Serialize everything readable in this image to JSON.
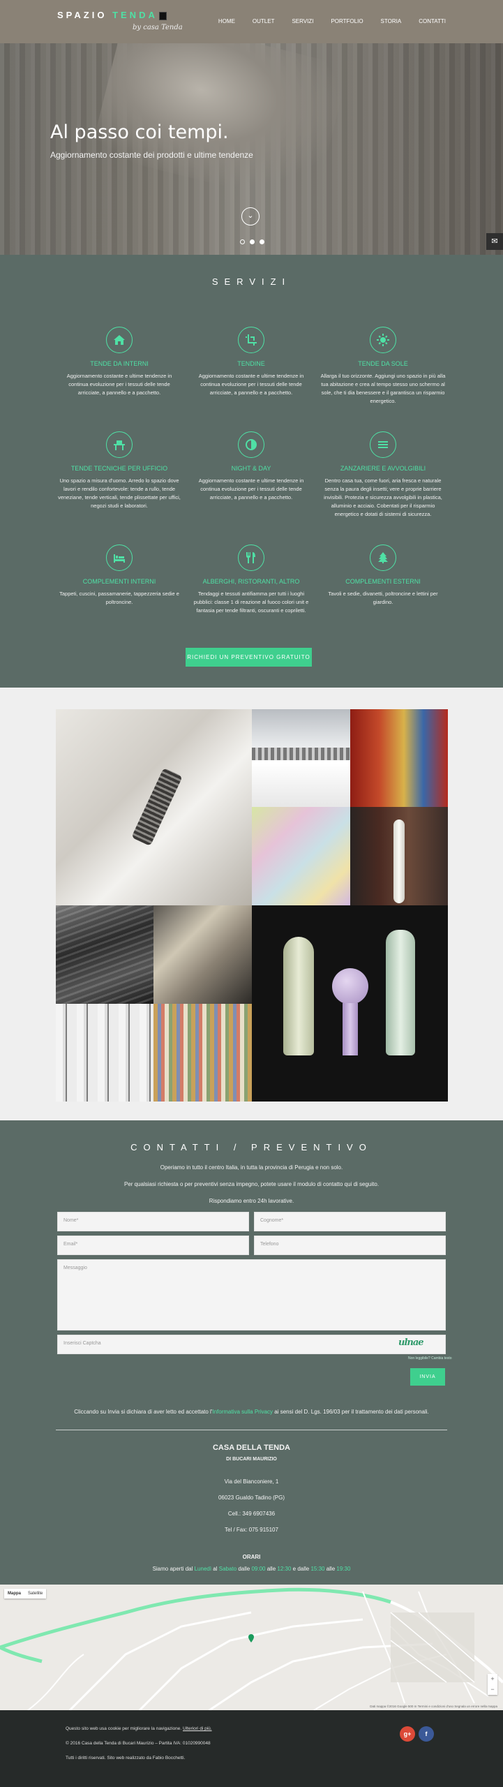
{
  "header": {
    "logo": {
      "main_a": "SPAZIO",
      "main_b": "TENDA",
      "sub": "by casa Tenda"
    },
    "nav": [
      "HOME",
      "OUTLET",
      "SERVIZI",
      "PORTFOLIO",
      "STORIA",
      "CONTATTI"
    ]
  },
  "hero": {
    "title": "Al passo coi tempi.",
    "subtitle": "Aggiornamento costante dei prodotti e ultime tendenze",
    "slides": 3,
    "active_slide": 1
  },
  "services": {
    "title": "SERVIZI",
    "items": [
      {
        "icon": "home-icon",
        "title": "TENDE DA INTERNI",
        "text": "Aggiornamento costante e ultime tendenze in continua evoluzione per i tessuti delle tende arricciate, a pannello e a pacchetto."
      },
      {
        "icon": "crop-icon",
        "title": "TENDINE",
        "text": "Aggiornamento costante e ultime tendenze in continua evoluzione per i tessuti delle tende arricciate, a pannello e a pacchetto."
      },
      {
        "icon": "sun-icon",
        "title": "TENDE DA SOLE",
        "text": "Allarga il tuo orizzonte. Aggiungi uno spazio in più alla tua abitazione e crea al tempo stesso uno schermo al sole, che ti dia benessere e il garantisca un risparmio energetico."
      },
      {
        "icon": "office-icon",
        "title": "TENDE TECNICHE PER UFFICIO",
        "text": "Uno spazio a misura d'uomo. Arredo lo spazio dove lavori e rendilo confortevole: tende a rullo, tende veneziane, tende verticali, tende plissettate per uffici, negozi studi e laboratori."
      },
      {
        "icon": "contrast-icon",
        "title": "NIGHT & DAY",
        "text": "Aggiornamento costante e ultime tendenze in continua evoluzione per i tessuti delle tende arricciate, a pannello e a pacchetto."
      },
      {
        "icon": "menu-icon",
        "title": "ZANZARIERE E AVVOLGIBILI",
        "text": "Dentro casa tua, come fuori, aria fresca e naturale senza la paura degli insetti; vere e proprie barriere invisibili. Protezia e sicurezza avvolgibili in plastica, alluminio e acciaio. Cobentati per il risparmio energetico e dotati di sistemi di sicurezza."
      },
      {
        "icon": "bed-icon",
        "title": "COMPLEMENTI INTERNI",
        "text": "Tappeti, cuscini, passamanerie, tappezzeria sedie e poltroncine."
      },
      {
        "icon": "restaurant-icon",
        "title": "ALBERGHI, RISTORANTI, ALTRO",
        "text": "Tendaggi e tessuti antifiamma per tutti i luoghi pubblici: classe 1 di reazione al fuoco colori unit e fantasia per tende filtranti, oscuranti e copriletti."
      },
      {
        "icon": "tree-icon",
        "title": "COMPLEMENTI ESTERNI",
        "text": "Tavoli e sedie, divanetti, poltroncine e lettini per giardino."
      }
    ],
    "cta": "RICHIEDI UN PREVENTIVO GRATUITO"
  },
  "contact": {
    "title": "CONTATTI / PREVENTIVO",
    "intro_1": "Operiamo in tutto il centro Italia, in tutta la provincia di Perugia e non solo.",
    "intro_2": "Per qualsiasi richiesta o per preventivi senza impegno, potete usare il modulo di contatto qui di seguito.",
    "intro_3": "Rispondiamo entro 24h lavorative.",
    "placeholders": {
      "name": "Nome*",
      "surname": "Cognome*",
      "email": "Email*",
      "phone": "Telefono",
      "message": "Messaggio",
      "captcha": "Inserisci Captcha"
    },
    "captcha_text": "ulnae",
    "captcha_refresh": "Non leggibile? Cambia testo",
    "send": "INVIA",
    "privacy_pre": "Cliccando su Invia si dichiara di aver letto ed accettato l'",
    "privacy_link": "Informativa sulla Privacy",
    "privacy_post": " ai sensi del D. Lgs. 196/03 per il trattamento dei dati personali.",
    "company": "CASA DELLA TENDA",
    "owner": "DI BUCARI MAURIZIO",
    "address": "Via del Bianconiere, 1",
    "city": "06023 Gualdo Tadino (PG)",
    "cell": "Cell.: 349 6907436",
    "tel": "Tel / Fax: 075 915107",
    "hours_title": "ORARI",
    "hours": {
      "a": "Siamo aperti dal ",
      "b": "Lunedì",
      "c": " al ",
      "d": "Sabato",
      "e": " dalle ",
      "f": "09:00",
      "g": " alle ",
      "h": "12:30",
      "i": " e dalle ",
      "j": "15:30",
      "k": " alle ",
      "l": "19:30"
    }
  },
  "map": {
    "tabs": [
      "Mappa",
      "Satellite"
    ],
    "attribution": "Dati mappa ©2016 Google   500 m   Termini e condizioni d'uso   Segnala un errore nella mappa"
  },
  "footer": {
    "cookie": "Questo sito web usa cookie per migliorare la navigazione.",
    "cookie_link": "Ulteriori di più.",
    "copyright": "© 2016 Casa della Tenda di Bucari Maurizio – Partita IVA: 01020990048",
    "rights": "Tutti i diritti riservati. Sito web realizzato da Fabio Bocchetti."
  },
  "colors": {
    "accent": "#4fe0a5",
    "section_bg": "#5b6b66",
    "header_bg": "#8a8276",
    "footer_bg": "#262a29"
  }
}
